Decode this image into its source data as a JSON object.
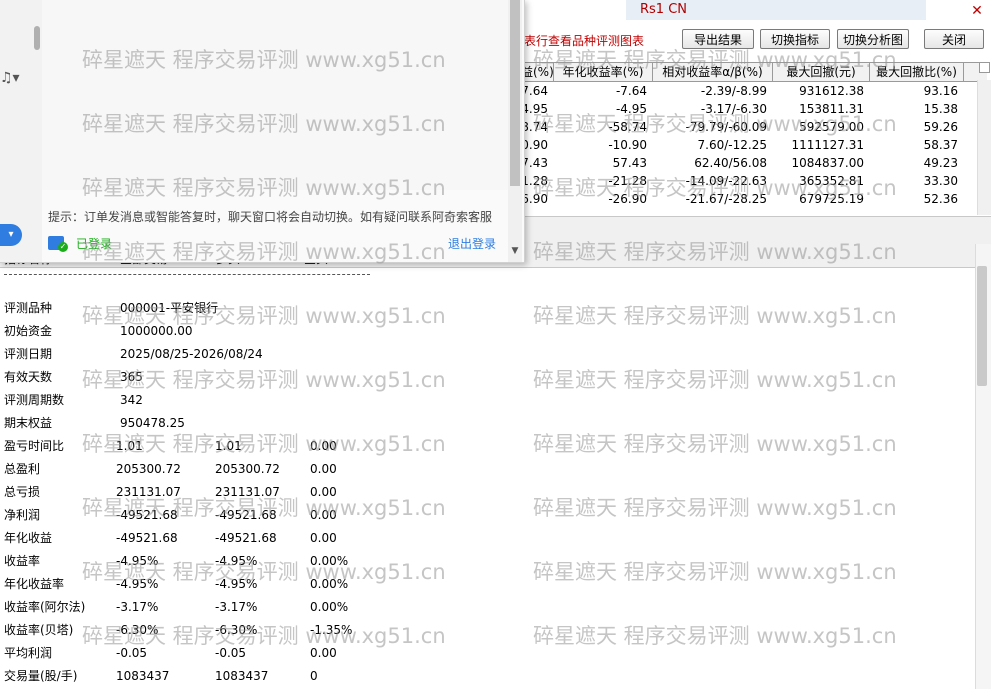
{
  "window": {
    "title_fragment": "Rs1 CN"
  },
  "toolbar": {
    "hint": "表行查看品种评测图表",
    "buttons": [
      "导出结果",
      "切换指标",
      "切换分析图",
      "关闭"
    ]
  },
  "table": {
    "columns": [
      "益(%)",
      "年化收益率(%)",
      "相对收益率α/β(%)",
      "最大回撤(元)",
      "最大回撤比(%)"
    ],
    "rows": [
      [
        "7.64",
        "-7.64",
        "-2.39/-8.99",
        "931612.38",
        "93.16"
      ],
      [
        "4.95",
        "-4.95",
        "-3.17/-6.30",
        "153811.31",
        "15.38"
      ],
      [
        "8.74",
        "-58.74",
        "-79.79/-60.09",
        "592579.00",
        "59.26"
      ],
      [
        "0.90",
        "-10.90",
        "7.60/-12.25",
        "1111127.31",
        "58.37"
      ],
      [
        "7.43",
        "57.43",
        "62.40/56.08",
        "1084837.00",
        "49.23"
      ],
      [
        "1.28",
        "-21.28",
        "-14.09/-22.63",
        "365352.81",
        "33.30"
      ],
      [
        "6.90",
        "-26.90",
        "-21.67/-28.25",
        "679725.19",
        "52.36"
      ]
    ]
  },
  "popup": {
    "hint": "提示：订单发消息或智能答复时，聊天窗口将会自动切换。如有疑问联系阿奇索客服",
    "login_status": "已登录",
    "logout": "退出登录"
  },
  "report": {
    "header_cols": [
      "指标名称",
      "全部交易",
      "多头",
      "空头"
    ],
    "rows": [
      {
        "label": "评测品种",
        "v": [
          "000001-平安银行"
        ]
      },
      {
        "label": "初始资金",
        "v": [
          "1000000.00"
        ]
      },
      {
        "label": "评测日期",
        "v": [
          "2025/08/25-2026/08/24"
        ]
      },
      {
        "label": "有效天数",
        "v": [
          "365"
        ]
      },
      {
        "label": "评测周期数",
        "v": [
          "342"
        ]
      },
      {
        "label": "期末权益",
        "v": [
          "950478.25"
        ]
      },
      {
        "label": "盈亏时间比",
        "v": [
          "1.01",
          "1.01",
          "0.00"
        ]
      },
      {
        "label": "总盈利",
        "v": [
          "205300.72",
          "205300.72",
          "0.00"
        ]
      },
      {
        "label": "总亏损",
        "v": [
          "231131.07",
          "231131.07",
          "0.00"
        ]
      },
      {
        "label": "净利润",
        "v": [
          "-49521.68",
          "-49521.68",
          "0.00"
        ]
      },
      {
        "label": "年化收益",
        "v": [
          "-49521.68",
          "-49521.68",
          "0.00"
        ]
      },
      {
        "label": "收益率",
        "v": [
          "-4.95%",
          "-4.95%",
          "0.00%"
        ]
      },
      {
        "label": "年化收益率",
        "v": [
          "-4.95%",
          "-4.95%",
          "0.00%"
        ]
      },
      {
        "label": "收益率(阿尔法)",
        "v": [
          "-3.17%",
          "-3.17%",
          "0.00%"
        ]
      },
      {
        "label": "收益率(贝塔)",
        "v": [
          "-6.30%",
          "-6.30%",
          "-1.35%"
        ]
      },
      {
        "label": "平均利润",
        "v": [
          "-0.05",
          "-0.05",
          "0.00"
        ]
      },
      {
        "label": "交易量(股/手)",
        "v": [
          "1083437",
          "1083437",
          "0"
        ]
      }
    ]
  },
  "watermark": "碎星遮天 程序交易评测 www.xg51.cn",
  "colors": {
    "hint_red": "#c00000",
    "link_blue": "#2f7de1",
    "ok_green": "#1aad19"
  }
}
